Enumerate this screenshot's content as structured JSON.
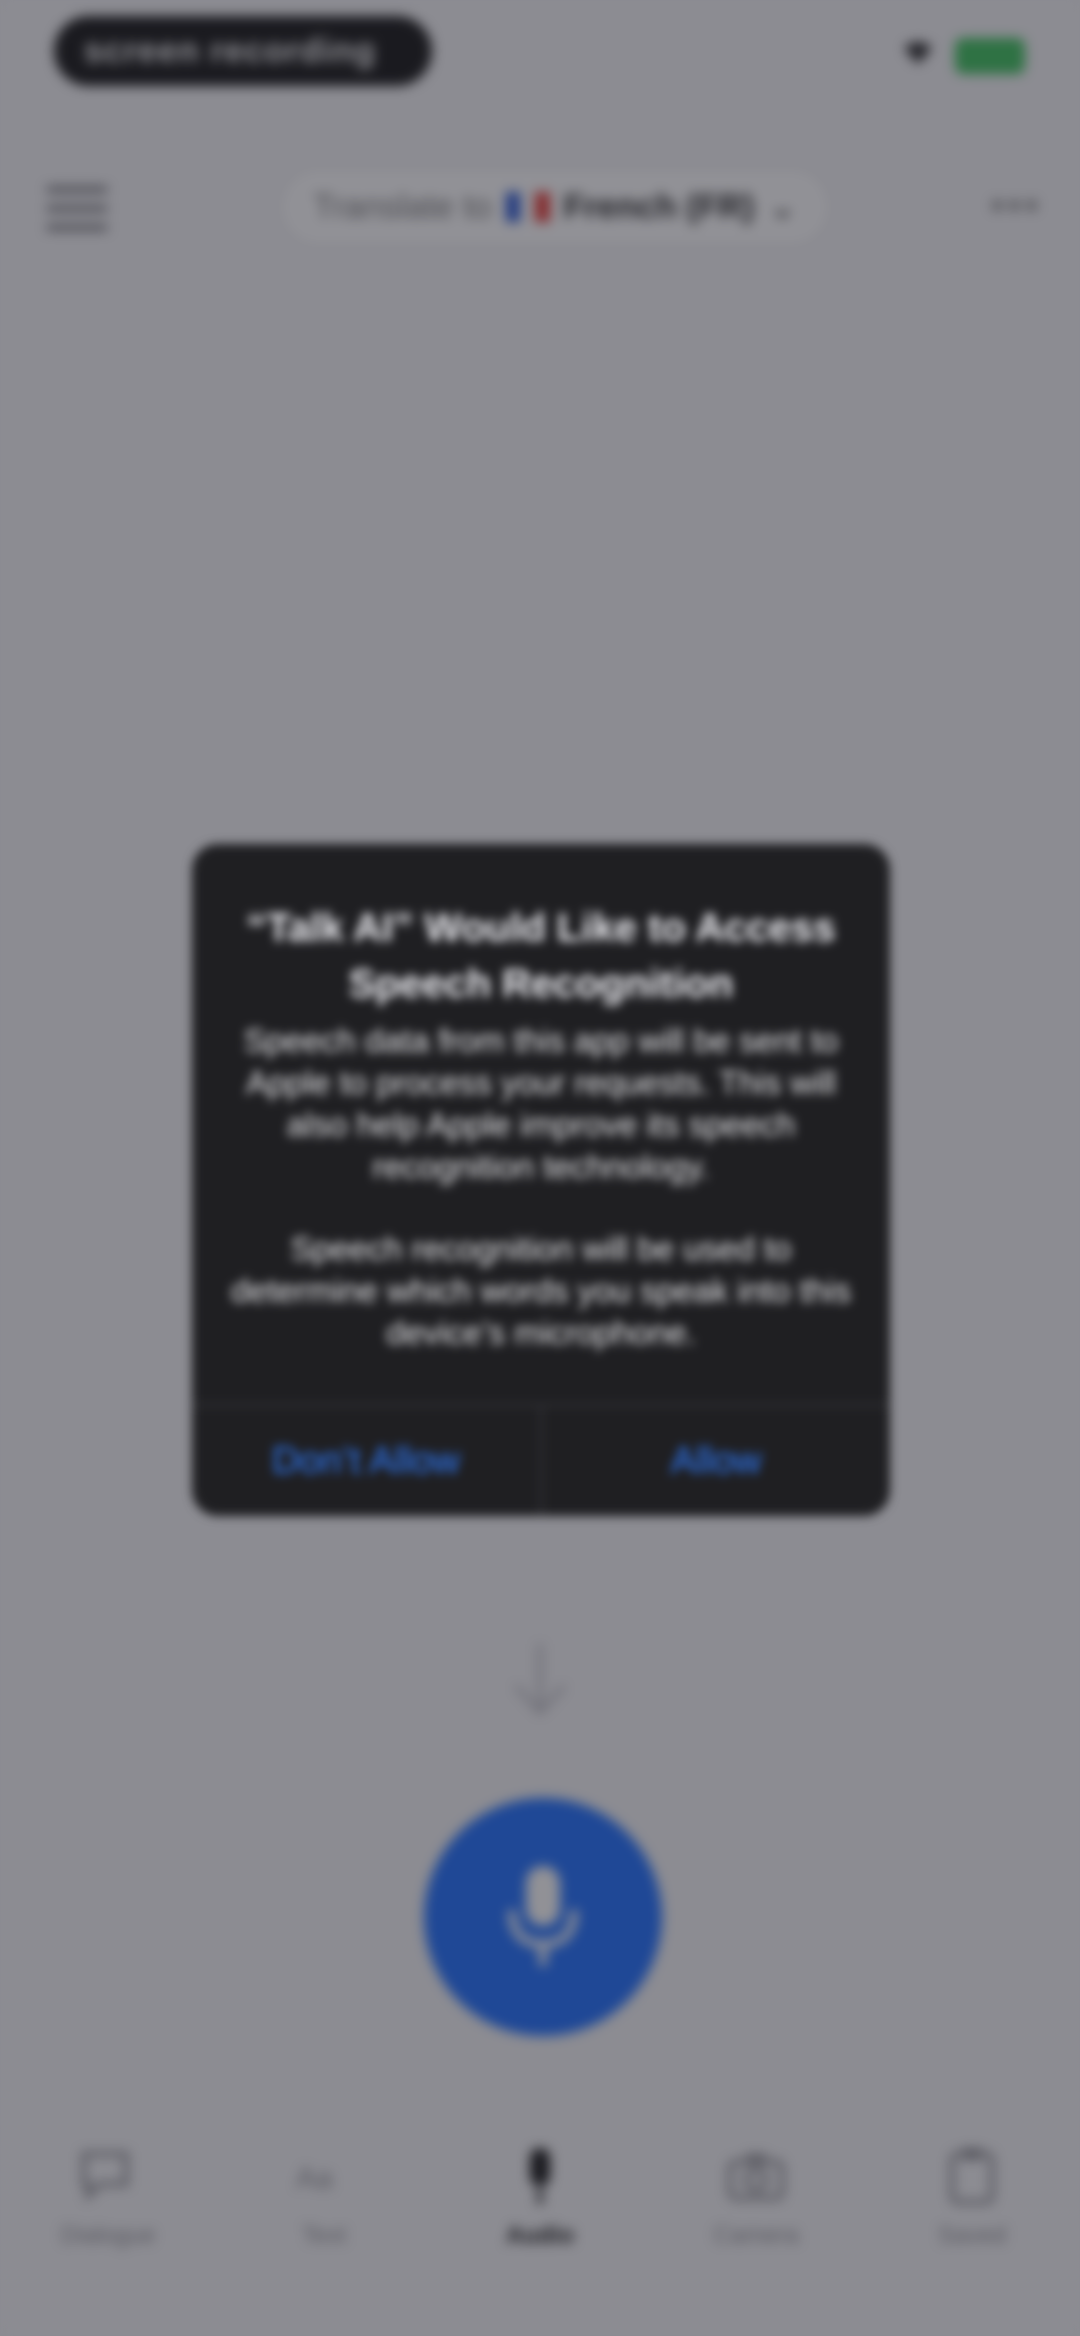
{
  "status_bar": {
    "pill_label": "screen recording",
    "wifi_icon": "wifi-icon",
    "battery_color": "#3ac05a"
  },
  "header": {
    "menu_icon": "menu-icon",
    "translate_prefix": "Translate to",
    "target_language": "French (FR)",
    "more_icon": "more-icon"
  },
  "main": {
    "arrow_icon": "arrow-down-icon",
    "mic_icon": "mic-icon",
    "mic_color": "#1a6cff"
  },
  "tabs": [
    {
      "label": "Dialogue",
      "icon": "chat-icon",
      "active": false
    },
    {
      "label": "Text",
      "icon": "text-icon",
      "active": false
    },
    {
      "label": "Audio",
      "icon": "mic-icon",
      "active": true
    },
    {
      "label": "Camera",
      "icon": "camera-icon",
      "active": false
    },
    {
      "label": "Saved",
      "icon": "clipboard-icon",
      "active": false
    }
  ],
  "alert": {
    "title": "“Talk AI” Would Like to Access Speech Recognition",
    "message_1": "Speech data from this app will be sent to Apple to process your requests. This will also help Apple improve its speech recognition technology.",
    "message_2": "Speech recognition will be used to determine which words you speak into this device’s microphone.",
    "deny_label": "Don’t Allow",
    "allow_label": "Allow",
    "button_color": "#2f7cff"
  }
}
